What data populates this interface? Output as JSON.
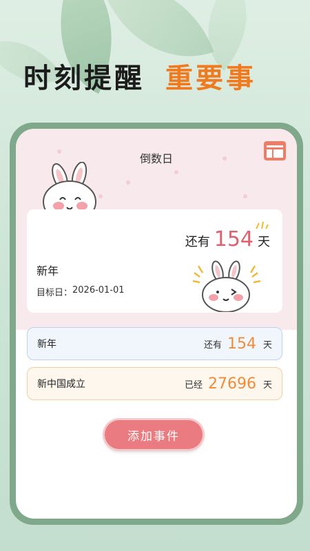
{
  "headline": {
    "part1": "时刻提醒",
    "part2": "重要事"
  },
  "app": {
    "title": "倒数日"
  },
  "hero": {
    "prefix": "还有",
    "count": "154",
    "unit": "天",
    "name": "新年",
    "target_label": "目标日：",
    "target_date": "2026-01-01"
  },
  "events": [
    {
      "name": "新年",
      "prefix": "还有",
      "count": "154",
      "unit": "天",
      "style": "blue"
    },
    {
      "name": "新中国成立",
      "prefix": "已经",
      "count": "27696",
      "unit": "天",
      "style": "orange"
    }
  ],
  "add_button": {
    "label": "添加事件"
  },
  "colors": {
    "accent_orange": "#ef7a1f",
    "count_red": "#e0616d",
    "frame_green": "#7fa98a",
    "button_pink": "#ea7b80"
  },
  "icons": {
    "menu": "layout-menu-icon",
    "bunny_big": "bunny-illustration",
    "bunny_small": "bunny-peek-illustration"
  }
}
